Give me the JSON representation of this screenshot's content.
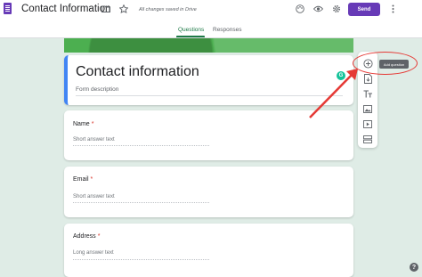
{
  "app": {
    "title": "Contact Information",
    "save_status": "All changes saved in Drive",
    "send_label": "Send"
  },
  "icons": {
    "folder": "folder-icon",
    "star": "star-icon",
    "palette": "palette-icon",
    "preview": "eye-icon",
    "settings": "gear-icon",
    "more": "more-vert-icon",
    "help": "help-icon"
  },
  "tabs": [
    {
      "label": "Questions",
      "active": true
    },
    {
      "label": "Responses",
      "active": false
    }
  ],
  "form": {
    "title": "Contact information",
    "description_placeholder": "Form description"
  },
  "questions": [
    {
      "label": "Name",
      "required": "*",
      "answer_placeholder": "Short answer text"
    },
    {
      "label": "Email",
      "required": "*",
      "answer_placeholder": "Short answer text"
    },
    {
      "label": "Address",
      "required": "*",
      "answer_placeholder": "Long answer text"
    }
  ],
  "sidebar": {
    "items": [
      {
        "icon": "add-circle-icon",
        "glyph": "⊕"
      },
      {
        "icon": "import-questions-icon",
        "glyph": ""
      },
      {
        "icon": "title-text-icon",
        "glyph": "Tт"
      },
      {
        "icon": "image-icon",
        "glyph": ""
      },
      {
        "icon": "video-icon",
        "glyph": ""
      },
      {
        "icon": "section-icon",
        "glyph": ""
      }
    ],
    "tooltip": "Add question"
  },
  "colors": {
    "brand_purple": "#673ab7",
    "accent_green": "#1e7a47",
    "header_green": "#4caf50",
    "title_card_accent": "#4285f4",
    "annotation_red": "#e53935"
  }
}
